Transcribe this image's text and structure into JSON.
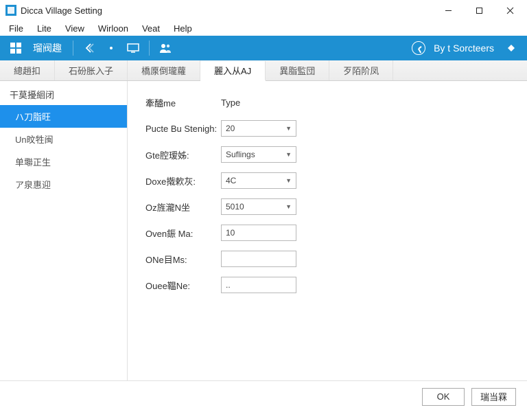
{
  "window": {
    "title": "Dicca Village Setting"
  },
  "menu": {
    "items": [
      "File",
      "Lite",
      "View",
      "Wirloon",
      "Veat",
      "Help"
    ]
  },
  "ribbon": {
    "label": "瑠阀趣",
    "right_label": "By t Sorcteers"
  },
  "tabs": [
    "總趙扣",
    "石砏胀入子",
    "橋厡倒瓏蘿",
    "麗入从AJ",
    "異脂監団",
    "歹陌阶凤"
  ],
  "active_tab_index": 3,
  "sidebar": {
    "heading": "干莫擾絗闭",
    "items": [
      "ハ刀脂旺",
      "Un旼牲闽",
      "单壣正生",
      "ア泉惠迎"
    ],
    "active_index": 0
  },
  "form": {
    "header_name": "牽醠me",
    "header_type": "Type",
    "rows": [
      {
        "label": "Pucte Bu Stenigh:",
        "kind": "combo",
        "value": "20"
      },
      {
        "label": "Gte腔瑷姊:",
        "kind": "combo",
        "value": "Suflings"
      },
      {
        "label": "Doxe撠欶灰:",
        "kind": "combo",
        "value": "4C"
      },
      {
        "label": "Oz旌瀧N坐",
        "kind": "combo",
        "value": "5010"
      },
      {
        "label": "Oven鋠 Ma:",
        "kind": "input",
        "value": "10"
      },
      {
        "label": "ONe目Ms:",
        "kind": "input",
        "value": ""
      },
      {
        "label": "Ouee鞰Ne:",
        "kind": "input",
        "value": ".."
      }
    ]
  },
  "footer": {
    "ok": "OK",
    "cancel": "瑞当罧"
  }
}
